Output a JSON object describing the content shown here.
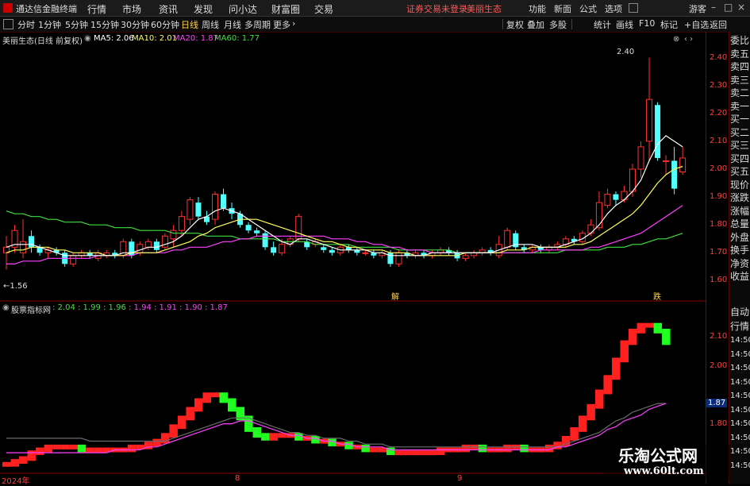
{
  "window": {
    "app_name": "通达信金融终端",
    "menu": [
      "行情",
      "市场",
      "资讯",
      "发现",
      "问小达",
      "财富圈",
      "交易"
    ],
    "warning": "证券交易未登录",
    "stock": "美丽生态",
    "right_menu": [
      "功能",
      "新面",
      "公式",
      "选项"
    ],
    "min_btn": "–",
    "max_btn": "□",
    "close_btn": "×"
  },
  "toolbar": {
    "periods": [
      "分时",
      "1分钟",
      "5分钟",
      "15分钟",
      "30分钟",
      "60分钟",
      "日线",
      "周线",
      "月线",
      "多周期",
      "更多"
    ],
    "active": "日线",
    "right": [
      "复权",
      "叠加",
      "多股",
      "统计",
      "画线",
      "F10",
      "标记",
      "+自选",
      "返回"
    ]
  },
  "main_chart": {
    "title": "美丽生态(日线 前复权)",
    "ma_labels": [
      {
        "text": "MA5: 2.06",
        "color": "#ffffff"
      },
      {
        "text": "MA10: 2.01",
        "color": "#ffff60"
      },
      {
        "text": "MA20: 1.87",
        "color": "#ff40ff"
      },
      {
        "text": "MA60: 1.77",
        "color": "#40e040"
      }
    ],
    "y_ticks": [
      "2.40",
      "2.30",
      "2.20",
      "2.10",
      "2.00",
      "1.90",
      "1.80",
      "1.70",
      "1.60"
    ],
    "high_label": "2.40",
    "low_label": "←1.56",
    "markers": [
      "解",
      "跌"
    ]
  },
  "sub_chart": {
    "title": "股票指标网",
    "values": [
      {
        "text": ": 2.04",
        "color": "#40e040"
      },
      {
        "text": ": 1.99",
        "color": "#40e040"
      },
      {
        "text": ": 1.96",
        "color": "#40e040"
      },
      {
        "text": ": 1.94",
        "color": "#ff40ff"
      },
      {
        "text": ": 1.91",
        "color": "#ff40ff"
      },
      {
        "text": ": 1.90",
        "color": "#ff40ff"
      },
      {
        "text": ": 1.87",
        "color": "#ff40ff"
      }
    ],
    "y_ticks": [
      "2.10",
      "2.00",
      "1.87",
      "1.80"
    ],
    "selected_tick": "1.87"
  },
  "x_axis": [
    "2024年",
    "8",
    "9"
  ],
  "side_panel": [
    "委比",
    "卖五",
    "卖四",
    "卖三",
    "卖二",
    "卖一",
    "买一",
    "买二",
    "买三",
    "买四",
    "买五",
    "现价",
    "涨跌",
    "涨幅",
    "总量",
    "外盘",
    "换手",
    "净资",
    "收益"
  ],
  "side_panel_lower": [
    "自动",
    "行情",
    "14:50",
    "14:50",
    "14:50",
    "14:50",
    "14:50",
    "14:50",
    "14:50",
    "14:50",
    "14:50",
    "14:50"
  ],
  "watermark": {
    "line1": "乐淘公式网",
    "line2": "www.60lt.com"
  },
  "colors": {
    "up": "#ff3030",
    "down": "#50ffff",
    "sub_up": "#ff2020",
    "sub_down": "#20ff20",
    "axis": "#8a0000"
  },
  "chart_data": {
    "type": "candlestick",
    "ylim": [
      1.53,
      2.45
    ],
    "candles": [
      [
        1.7,
        1.72,
        1.64,
        1.76
      ],
      [
        1.72,
        1.78,
        1.7,
        1.8
      ],
      [
        1.7,
        1.74,
        1.68,
        1.82
      ],
      [
        1.76,
        1.72,
        1.7,
        1.78
      ],
      [
        1.72,
        1.7,
        1.69,
        1.73
      ],
      [
        1.7,
        1.71,
        1.68,
        1.72
      ],
      [
        1.71,
        1.7,
        1.69,
        1.72
      ],
      [
        1.7,
        1.66,
        1.65,
        1.71
      ],
      [
        1.66,
        1.69,
        1.65,
        1.7
      ],
      [
        1.69,
        1.7,
        1.68,
        1.71
      ],
      [
        1.7,
        1.69,
        1.68,
        1.71
      ],
      [
        1.68,
        1.7,
        1.67,
        1.71
      ],
      [
        1.69,
        1.7,
        1.68,
        1.71
      ],
      [
        1.7,
        1.69,
        1.68,
        1.71
      ],
      [
        1.69,
        1.74,
        1.68,
        1.75
      ],
      [
        1.74,
        1.69,
        1.68,
        1.75
      ],
      [
        1.7,
        1.73,
        1.69,
        1.74
      ],
      [
        1.72,
        1.74,
        1.71,
        1.75
      ],
      [
        1.74,
        1.71,
        1.7,
        1.75
      ],
      [
        1.72,
        1.76,
        1.71,
        1.77
      ],
      [
        1.75,
        1.78,
        1.72,
        1.8
      ],
      [
        1.78,
        1.83,
        1.76,
        1.85
      ],
      [
        1.82,
        1.89,
        1.8,
        1.9
      ],
      [
        1.88,
        1.83,
        1.82,
        1.9
      ],
      [
        1.83,
        1.81,
        1.8,
        1.85
      ],
      [
        1.82,
        1.91,
        1.8,
        1.92
      ],
      [
        1.91,
        1.86,
        1.85,
        1.93
      ],
      [
        1.86,
        1.84,
        1.82,
        1.88
      ],
      [
        1.84,
        1.8,
        1.79,
        1.85
      ],
      [
        1.8,
        1.78,
        1.77,
        1.81
      ],
      [
        1.78,
        1.77,
        1.76,
        1.79
      ],
      [
        1.77,
        1.72,
        1.71,
        1.78
      ],
      [
        1.72,
        1.7,
        1.69,
        1.74
      ],
      [
        1.7,
        1.73,
        1.69,
        1.75
      ],
      [
        1.73,
        1.75,
        1.72,
        1.76
      ],
      [
        1.75,
        1.83,
        1.74,
        1.84
      ],
      [
        1.74,
        1.72,
        1.71,
        1.75
      ],
      [
        1.73,
        1.74,
        1.72,
        1.75
      ],
      [
        1.72,
        1.71,
        1.7,
        1.73
      ],
      [
        1.71,
        1.7,
        1.69,
        1.72
      ],
      [
        1.7,
        1.72,
        1.69,
        1.73
      ],
      [
        1.72,
        1.71,
        1.7,
        1.73
      ],
      [
        1.71,
        1.7,
        1.69,
        1.72
      ],
      [
        1.7,
        1.7,
        1.69,
        1.71
      ],
      [
        1.7,
        1.69,
        1.68,
        1.71
      ],
      [
        1.69,
        1.7,
        1.68,
        1.71
      ],
      [
        1.7,
        1.66,
        1.65,
        1.71
      ],
      [
        1.66,
        1.7,
        1.65,
        1.71
      ],
      [
        1.7,
        1.69,
        1.68,
        1.71
      ],
      [
        1.69,
        1.7,
        1.68,
        1.71
      ],
      [
        1.7,
        1.69,
        1.68,
        1.71
      ],
      [
        1.69,
        1.7,
        1.68,
        1.71
      ],
      [
        1.7,
        1.71,
        1.69,
        1.72
      ],
      [
        1.71,
        1.7,
        1.69,
        1.72
      ],
      [
        1.7,
        1.68,
        1.67,
        1.71
      ],
      [
        1.68,
        1.69,
        1.67,
        1.7
      ],
      [
        1.69,
        1.7,
        1.68,
        1.71
      ],
      [
        1.7,
        1.71,
        1.69,
        1.72
      ],
      [
        1.71,
        1.7,
        1.69,
        1.72
      ],
      [
        1.69,
        1.73,
        1.68,
        1.76
      ],
      [
        1.72,
        1.78,
        1.71,
        1.79
      ],
      [
        1.77,
        1.72,
        1.71,
        1.78
      ],
      [
        1.72,
        1.71,
        1.7,
        1.73
      ],
      [
        1.71,
        1.72,
        1.7,
        1.73
      ],
      [
        1.72,
        1.71,
        1.7,
        1.73
      ],
      [
        1.71,
        1.72,
        1.7,
        1.73
      ],
      [
        1.72,
        1.73,
        1.71,
        1.74
      ],
      [
        1.73,
        1.75,
        1.72,
        1.76
      ],
      [
        1.75,
        1.74,
        1.73,
        1.76
      ],
      [
        1.74,
        1.77,
        1.73,
        1.78
      ],
      [
        1.77,
        1.8,
        1.76,
        1.82
      ],
      [
        1.79,
        1.88,
        1.78,
        1.92
      ],
      [
        1.87,
        1.91,
        1.86,
        1.93
      ],
      [
        1.91,
        1.89,
        1.87,
        1.92
      ],
      [
        1.89,
        1.92,
        1.88,
        1.94
      ],
      [
        1.92,
        2.0,
        1.9,
        2.02
      ],
      [
        2.0,
        2.08,
        1.97,
        2.1
      ],
      [
        2.1,
        2.25,
        2.03,
        2.4
      ],
      [
        2.23,
        2.04,
        2.03,
        2.24
      ],
      [
        2.03,
        2.03,
        1.98,
        2.05
      ],
      [
        2.03,
        1.93,
        1.91,
        2.08
      ],
      [
        1.99,
        2.04,
        1.98,
        2.08
      ]
    ],
    "ma5": [
      1.72,
      1.73,
      1.73,
      1.73,
      1.72,
      1.71,
      1.7,
      1.69,
      1.69,
      1.69,
      1.69,
      1.69,
      1.69,
      1.69,
      1.7,
      1.7,
      1.71,
      1.72,
      1.72,
      1.73,
      1.74,
      1.76,
      1.79,
      1.82,
      1.83,
      1.85,
      1.86,
      1.85,
      1.84,
      1.82,
      1.8,
      1.78,
      1.76,
      1.74,
      1.73,
      1.75,
      1.75,
      1.74,
      1.73,
      1.72,
      1.71,
      1.71,
      1.71,
      1.71,
      1.7,
      1.7,
      1.69,
      1.69,
      1.69,
      1.69,
      1.69,
      1.7,
      1.7,
      1.7,
      1.7,
      1.7,
      1.7,
      1.7,
      1.7,
      1.71,
      1.72,
      1.73,
      1.73,
      1.73,
      1.72,
      1.72,
      1.72,
      1.73,
      1.74,
      1.75,
      1.77,
      1.8,
      1.84,
      1.87,
      1.89,
      1.92,
      1.96,
      2.03,
      2.09,
      2.12,
      2.1,
      2.08
    ],
    "ma10": [
      1.7,
      1.71,
      1.71,
      1.72,
      1.72,
      1.72,
      1.71,
      1.71,
      1.7,
      1.7,
      1.7,
      1.7,
      1.69,
      1.69,
      1.69,
      1.7,
      1.7,
      1.7,
      1.7,
      1.71,
      1.72,
      1.73,
      1.74,
      1.76,
      1.77,
      1.79,
      1.8,
      1.81,
      1.82,
      1.82,
      1.82,
      1.81,
      1.8,
      1.79,
      1.78,
      1.77,
      1.76,
      1.75,
      1.74,
      1.74,
      1.73,
      1.72,
      1.72,
      1.71,
      1.71,
      1.71,
      1.7,
      1.7,
      1.7,
      1.69,
      1.69,
      1.69,
      1.69,
      1.69,
      1.69,
      1.7,
      1.7,
      1.7,
      1.7,
      1.7,
      1.71,
      1.71,
      1.71,
      1.72,
      1.72,
      1.72,
      1.72,
      1.72,
      1.73,
      1.73,
      1.74,
      1.76,
      1.78,
      1.8,
      1.82,
      1.84,
      1.87,
      1.91,
      1.95,
      1.98,
      2.0,
      2.01
    ],
    "ma20": [
      1.66,
      1.66,
      1.67,
      1.67,
      1.67,
      1.68,
      1.68,
      1.68,
      1.68,
      1.68,
      1.68,
      1.69,
      1.69,
      1.69,
      1.69,
      1.69,
      1.7,
      1.7,
      1.7,
      1.7,
      1.71,
      1.71,
      1.72,
      1.72,
      1.72,
      1.73,
      1.74,
      1.74,
      1.75,
      1.75,
      1.76,
      1.76,
      1.76,
      1.76,
      1.76,
      1.76,
      1.76,
      1.76,
      1.76,
      1.75,
      1.75,
      1.75,
      1.74,
      1.74,
      1.73,
      1.73,
      1.72,
      1.72,
      1.71,
      1.71,
      1.71,
      1.7,
      1.7,
      1.7,
      1.7,
      1.7,
      1.7,
      1.7,
      1.7,
      1.7,
      1.7,
      1.7,
      1.7,
      1.7,
      1.71,
      1.71,
      1.71,
      1.71,
      1.71,
      1.71,
      1.72,
      1.72,
      1.73,
      1.74,
      1.75,
      1.76,
      1.77,
      1.79,
      1.81,
      1.83,
      1.85,
      1.87
    ],
    "ma60": [
      1.85,
      1.84,
      1.84,
      1.83,
      1.83,
      1.82,
      1.82,
      1.81,
      1.81,
      1.81,
      1.8,
      1.8,
      1.8,
      1.79,
      1.79,
      1.79,
      1.78,
      1.78,
      1.78,
      1.78,
      1.77,
      1.77,
      1.77,
      1.77,
      1.76,
      1.76,
      1.76,
      1.76,
      1.75,
      1.75,
      1.75,
      1.75,
      1.75,
      1.74,
      1.74,
      1.74,
      1.74,
      1.73,
      1.73,
      1.73,
      1.73,
      1.73,
      1.72,
      1.72,
      1.72,
      1.72,
      1.72,
      1.71,
      1.71,
      1.71,
      1.71,
      1.71,
      1.71,
      1.71,
      1.7,
      1.7,
      1.7,
      1.7,
      1.7,
      1.7,
      1.7,
      1.7,
      1.7,
      1.7,
      1.7,
      1.7,
      1.7,
      1.71,
      1.71,
      1.71,
      1.71,
      1.71,
      1.72,
      1.72,
      1.72,
      1.73,
      1.73,
      1.74,
      1.75,
      1.75,
      1.76,
      1.77
    ],
    "sub": {
      "ylim": [
        1.64,
        2.18
      ],
      "band": [
        1.66,
        1.67,
        1.68,
        1.7,
        1.71,
        1.72,
        1.72,
        1.72,
        1.72,
        1.71,
        1.71,
        1.71,
        1.71,
        1.71,
        1.71,
        1.72,
        1.72,
        1.73,
        1.74,
        1.76,
        1.79,
        1.82,
        1.85,
        1.88,
        1.9,
        1.9,
        1.88,
        1.85,
        1.82,
        1.78,
        1.76,
        1.75,
        1.76,
        1.76,
        1.76,
        1.75,
        1.75,
        1.74,
        1.74,
        1.73,
        1.73,
        1.72,
        1.72,
        1.71,
        1.71,
        1.71,
        1.7,
        1.7,
        1.7,
        1.7,
        1.7,
        1.7,
        1.71,
        1.71,
        1.71,
        1.72,
        1.72,
        1.71,
        1.71,
        1.71,
        1.72,
        1.72,
        1.71,
        1.71,
        1.71,
        1.72,
        1.73,
        1.75,
        1.78,
        1.82,
        1.86,
        1.91,
        1.96,
        2.02,
        2.08,
        2.12,
        2.14,
        2.14,
        2.12,
        2.08
      ],
      "trend": [
        1.75,
        1.75,
        1.75,
        1.75,
        1.75,
        1.75,
        1.75,
        1.75,
        1.75,
        1.75,
        1.74,
        1.74,
        1.74,
        1.74,
        1.74,
        1.74,
        1.74,
        1.74,
        1.74,
        1.74,
        1.75,
        1.76,
        1.77,
        1.78,
        1.79,
        1.8,
        1.81,
        1.82,
        1.82,
        1.82,
        1.81,
        1.8,
        1.79,
        1.78,
        1.77,
        1.77,
        1.76,
        1.76,
        1.75,
        1.75,
        1.75,
        1.74,
        1.74,
        1.73,
        1.73,
        1.73,
        1.72,
        1.72,
        1.72,
        1.72,
        1.72,
        1.72,
        1.72,
        1.72,
        1.72,
        1.72,
        1.72,
        1.72,
        1.72,
        1.72,
        1.72,
        1.72,
        1.72,
        1.72,
        1.72,
        1.72,
        1.72,
        1.73,
        1.74,
        1.75,
        1.76,
        1.77,
        1.79,
        1.81,
        1.82,
        1.84,
        1.85,
        1.86,
        1.87,
        1.87
      ],
      "ma": [
        1.7,
        1.7,
        1.7,
        1.7,
        1.7,
        1.7,
        1.7,
        1.7,
        1.7,
        1.7,
        1.7,
        1.7,
        1.7,
        1.71,
        1.71,
        1.71,
        1.71,
        1.72,
        1.72,
        1.73,
        1.74,
        1.75,
        1.76,
        1.77,
        1.78,
        1.79,
        1.8,
        1.8,
        1.81,
        1.81,
        1.8,
        1.79,
        1.78,
        1.77,
        1.76,
        1.76,
        1.75,
        1.75,
        1.74,
        1.74,
        1.73,
        1.73,
        1.72,
        1.72,
        1.72,
        1.72,
        1.71,
        1.71,
        1.71,
        1.71,
        1.71,
        1.71,
        1.71,
        1.71,
        1.71,
        1.71,
        1.71,
        1.71,
        1.71,
        1.71,
        1.71,
        1.71,
        1.71,
        1.71,
        1.71,
        1.71,
        1.72,
        1.72,
        1.73,
        1.74,
        1.75,
        1.76,
        1.78,
        1.79,
        1.81,
        1.82,
        1.83,
        1.85,
        1.86,
        1.87
      ]
    }
  }
}
